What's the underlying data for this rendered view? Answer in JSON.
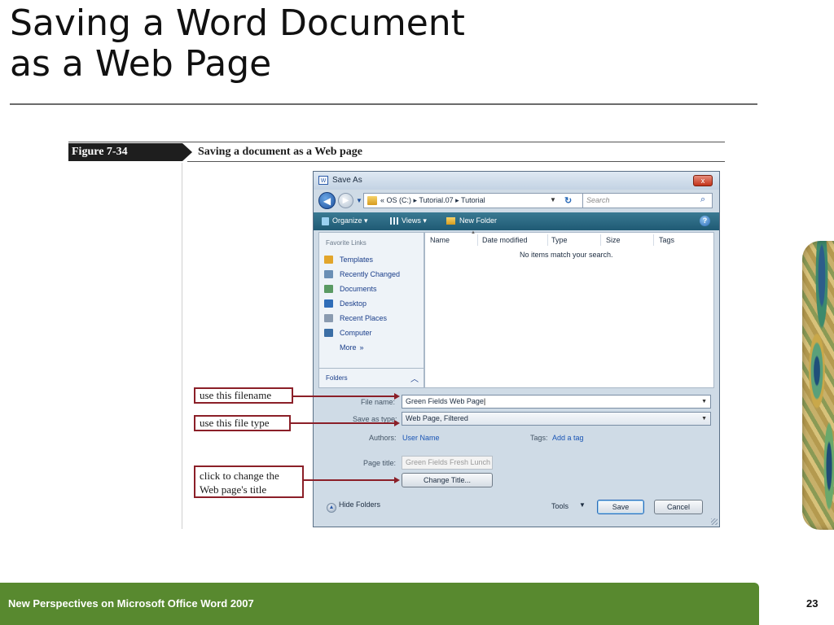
{
  "slide": {
    "title_line1": "Saving a Word Document",
    "title_line2": "as a Web Page",
    "footer_text": "New Perspectives on Microsoft Office Word 2007",
    "page_number": "23"
  },
  "figure": {
    "label": "Figure  7-34",
    "caption": "Saving a document as a Web page"
  },
  "dialog": {
    "title": "Save As",
    "close": "x",
    "address": {
      "chevrons": "«",
      "crumbs": [
        "OS (C:)",
        "Tutorial.07",
        "Tutorial"
      ],
      "separator": "▸"
    },
    "search_placeholder": "Search",
    "toolbar": {
      "organize": "Organize",
      "views": "Views",
      "new_folder": "New Folder"
    },
    "favorite_links_header": "Favorite Links",
    "favorites": [
      {
        "label": "Templates",
        "icon": "folder-icon",
        "color": "#e2a52b"
      },
      {
        "label": "Recently Changed",
        "icon": "recent-changed-icon",
        "color": "#6b8fb5"
      },
      {
        "label": "Documents",
        "icon": "documents-icon",
        "color": "#5a9a63"
      },
      {
        "label": "Desktop",
        "icon": "desktop-icon",
        "color": "#2f6db8"
      },
      {
        "label": "Recent Places",
        "icon": "recent-places-icon",
        "color": "#8a9bb0"
      },
      {
        "label": "Computer",
        "icon": "computer-icon",
        "color": "#3b6ea5"
      }
    ],
    "more_label": "More",
    "more_glyph": "»",
    "folders_label": "Folders",
    "columns": [
      "Name",
      "Date modified",
      "Type",
      "Size",
      "Tags"
    ],
    "empty_message": "No items match your search.",
    "file_name_label": "File name:",
    "file_name_value": "Green Fields Web Page",
    "save_type_label": "Save as type:",
    "save_type_value": "Web Page, Filtered",
    "authors_label": "Authors:",
    "authors_value": "User Name",
    "tags_label": "Tags:",
    "tags_value": "Add a tag",
    "page_title_label": "Page title:",
    "page_title_value": "Green Fields Fresh Lunch",
    "change_title_button": "Change Title...",
    "hide_folders": "Hide Folders",
    "tools": "Tools",
    "save_button": "Save",
    "cancel_button": "Cancel"
  },
  "callouts": {
    "filename": "use this filename",
    "filetype": "use this file type",
    "change_title_line1": "click to change the",
    "change_title_line2": "Web page's title"
  },
  "colors": {
    "footer_bar": "#58892f",
    "callout_border": "#8b1f28",
    "toolbar": "#1f5a74"
  }
}
